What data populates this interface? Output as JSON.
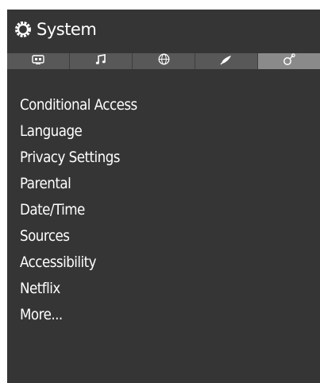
{
  "window": {
    "title": "System"
  },
  "tabs": [
    {
      "icon": "tv-icon",
      "active": false
    },
    {
      "icon": "music-note-icon",
      "active": false
    },
    {
      "icon": "globe-icon",
      "active": false
    },
    {
      "icon": "satellite-icon",
      "active": false
    },
    {
      "icon": "system-settings-icon",
      "active": true
    }
  ],
  "menu": {
    "items": [
      {
        "label": "Conditional Access"
      },
      {
        "label": "Language"
      },
      {
        "label": "Privacy Settings"
      },
      {
        "label": "Parental"
      },
      {
        "label": "Date/Time"
      },
      {
        "label": "Sources"
      },
      {
        "label": "Accessibility"
      },
      {
        "label": "Netflix"
      },
      {
        "label": "More..."
      }
    ]
  },
  "colors": {
    "panel_bg": "#353535",
    "tab_bg": "#585858",
    "tab_active_bg": "#8a8a8a",
    "text": "#ffffff"
  }
}
